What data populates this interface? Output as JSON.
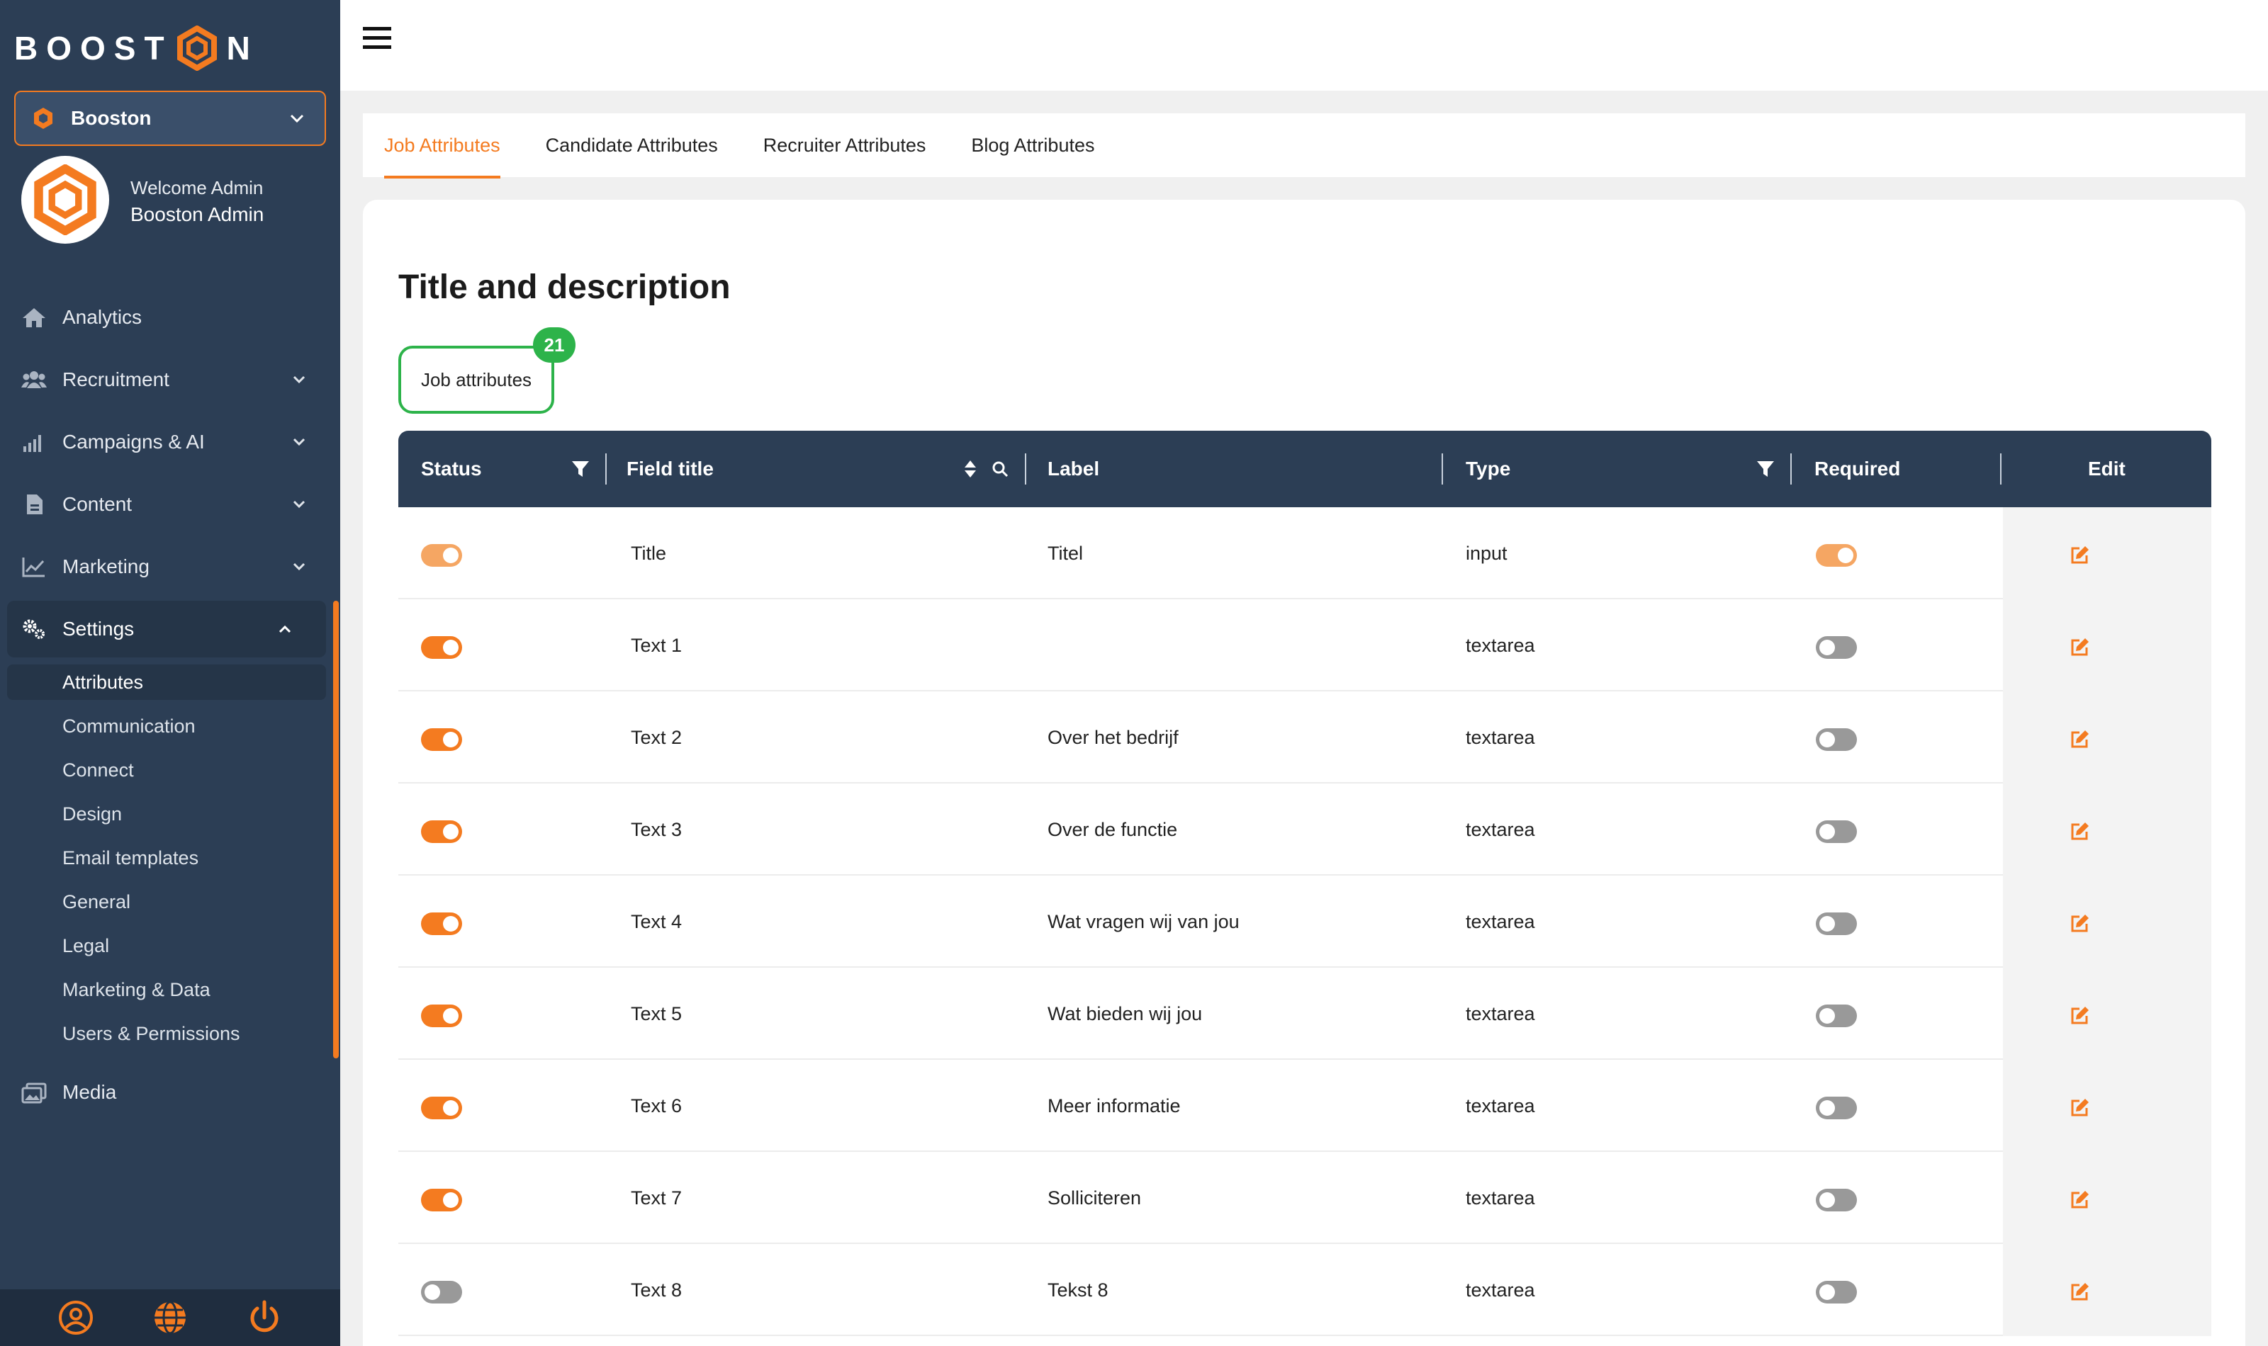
{
  "brand": {
    "logo_text_left": "BOOST",
    "logo_text_right": "N",
    "accent": "#f47b20",
    "sidebar_bg": "#2c3e55",
    "success": "#2db34a"
  },
  "org_selector": {
    "value": "Booston"
  },
  "user": {
    "welcome": "Welcome Admin",
    "name": "Booston Admin"
  },
  "nav": [
    {
      "label": "Analytics",
      "icon": "home-icon"
    },
    {
      "label": "Recruitment",
      "icon": "users-icon"
    },
    {
      "label": "Campaigns & AI",
      "icon": "signal-icon"
    },
    {
      "label": "Content",
      "icon": "file-icon"
    },
    {
      "label": "Marketing",
      "icon": "chart-line-icon"
    },
    {
      "label": "Settings",
      "icon": "gears-icon"
    },
    {
      "label": "Media",
      "icon": "images-icon"
    }
  ],
  "settings_sub": [
    "Attributes",
    "Communication",
    "Connect",
    "Design",
    "Email templates",
    "General",
    "Legal",
    "Marketing & Data",
    "Users & Permissions"
  ],
  "tabs": [
    "Job Attributes",
    "Candidate Attributes",
    "Recruiter Attributes",
    "Blog Attributes"
  ],
  "section": {
    "title": "Title and description",
    "group_label": "Job attributes",
    "count": "21"
  },
  "table": {
    "headers": {
      "status": "Status",
      "field_title": "Field title",
      "label": "Label",
      "type": "Type",
      "required": "Required",
      "edit": "Edit"
    },
    "rows": [
      {
        "status": true,
        "title": "Title",
        "label": "Titel",
        "type": "input",
        "required": true
      },
      {
        "status": true,
        "title": "Text 1",
        "label": "",
        "type": "textarea",
        "required": false
      },
      {
        "status": true,
        "title": "Text 2",
        "label": "Over het bedrijf",
        "type": "textarea",
        "required": false
      },
      {
        "status": true,
        "title": "Text 3",
        "label": "Over de functie",
        "type": "textarea",
        "required": false
      },
      {
        "status": true,
        "title": "Text 4",
        "label": "Wat vragen wij van jou",
        "type": "textarea",
        "required": false
      },
      {
        "status": true,
        "title": "Text 5",
        "label": "Wat bieden wij jou",
        "type": "textarea",
        "required": false
      },
      {
        "status": true,
        "title": "Text 6",
        "label": "Meer informatie",
        "type": "textarea",
        "required": false
      },
      {
        "status": true,
        "title": "Text 7",
        "label": "Solliciteren",
        "type": "textarea",
        "required": false
      },
      {
        "status": false,
        "title": "Text 8",
        "label": "Tekst 8",
        "type": "textarea",
        "required": false
      }
    ]
  }
}
